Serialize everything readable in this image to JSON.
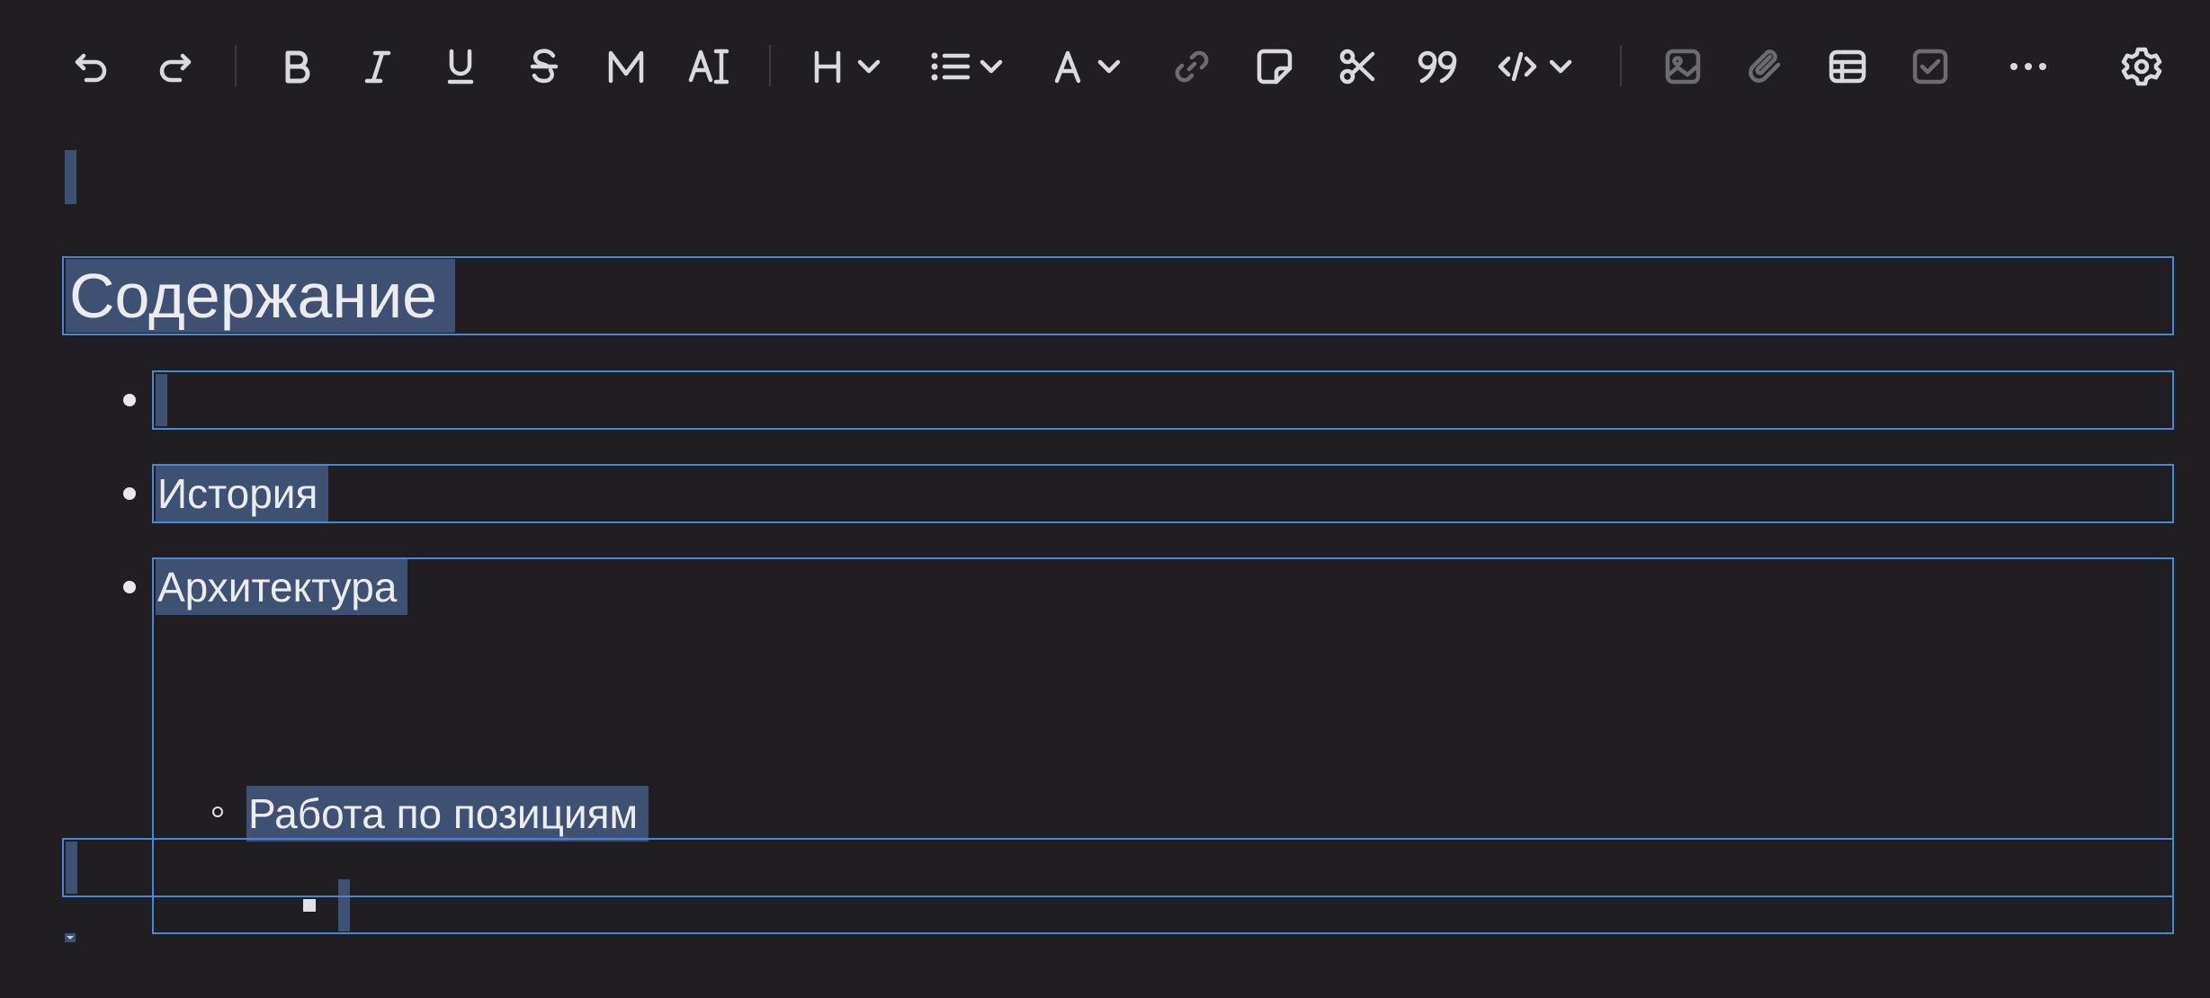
{
  "toolbar": {
    "items": [
      {
        "name": "undo-button",
        "icon": "undo-icon"
      },
      {
        "name": "redo-button",
        "icon": "redo-icon"
      },
      {
        "name": "bold-button",
        "icon": "bold-icon"
      },
      {
        "name": "italic-button",
        "icon": "italic-icon"
      },
      {
        "name": "underline-button",
        "icon": "underline-icon"
      },
      {
        "name": "strikethrough-button",
        "icon": "strikethrough-icon"
      },
      {
        "name": "mark-button",
        "icon": "mark-icon"
      },
      {
        "name": "clear-format-button",
        "icon": "clear-format-icon"
      },
      {
        "name": "heading-dropdown",
        "icon": "heading-icon"
      },
      {
        "name": "list-dropdown",
        "icon": "bulleted-list-icon"
      },
      {
        "name": "font-color-dropdown",
        "icon": "font-color-icon"
      },
      {
        "name": "link-button",
        "icon": "link-icon",
        "state": "disabled"
      },
      {
        "name": "sticky-note-button",
        "icon": "sticky-note-icon"
      },
      {
        "name": "cut-button",
        "icon": "scissors-icon"
      },
      {
        "name": "quote-button",
        "icon": "quote-icon"
      },
      {
        "name": "code-dropdown",
        "icon": "code-icon"
      },
      {
        "name": "image-button",
        "icon": "image-icon",
        "state": "disabled"
      },
      {
        "name": "attachment-button",
        "icon": "paperclip-icon",
        "state": "disabled"
      },
      {
        "name": "table-button",
        "icon": "table-icon"
      },
      {
        "name": "checkbox-button",
        "icon": "checkbox-icon",
        "state": "disabled"
      },
      {
        "name": "more-button",
        "icon": "more-horizontal-icon"
      },
      {
        "name": "settings-button",
        "icon": "gear-icon"
      }
    ]
  },
  "document": {
    "heading": "Содержание",
    "items": [
      {
        "label": ""
      },
      {
        "label": "История"
      },
      {
        "label": "Архитектура",
        "children": [
          {
            "label": "Работа по позициям",
            "children": [
              {
                "label": ""
              }
            ]
          }
        ]
      }
    ]
  },
  "colors": {
    "background": "#201e23",
    "selection": "#3f5173",
    "block_outline": "#4a88d6",
    "icon": "#d9d9de",
    "icon_disabled": "#6c6b72"
  }
}
